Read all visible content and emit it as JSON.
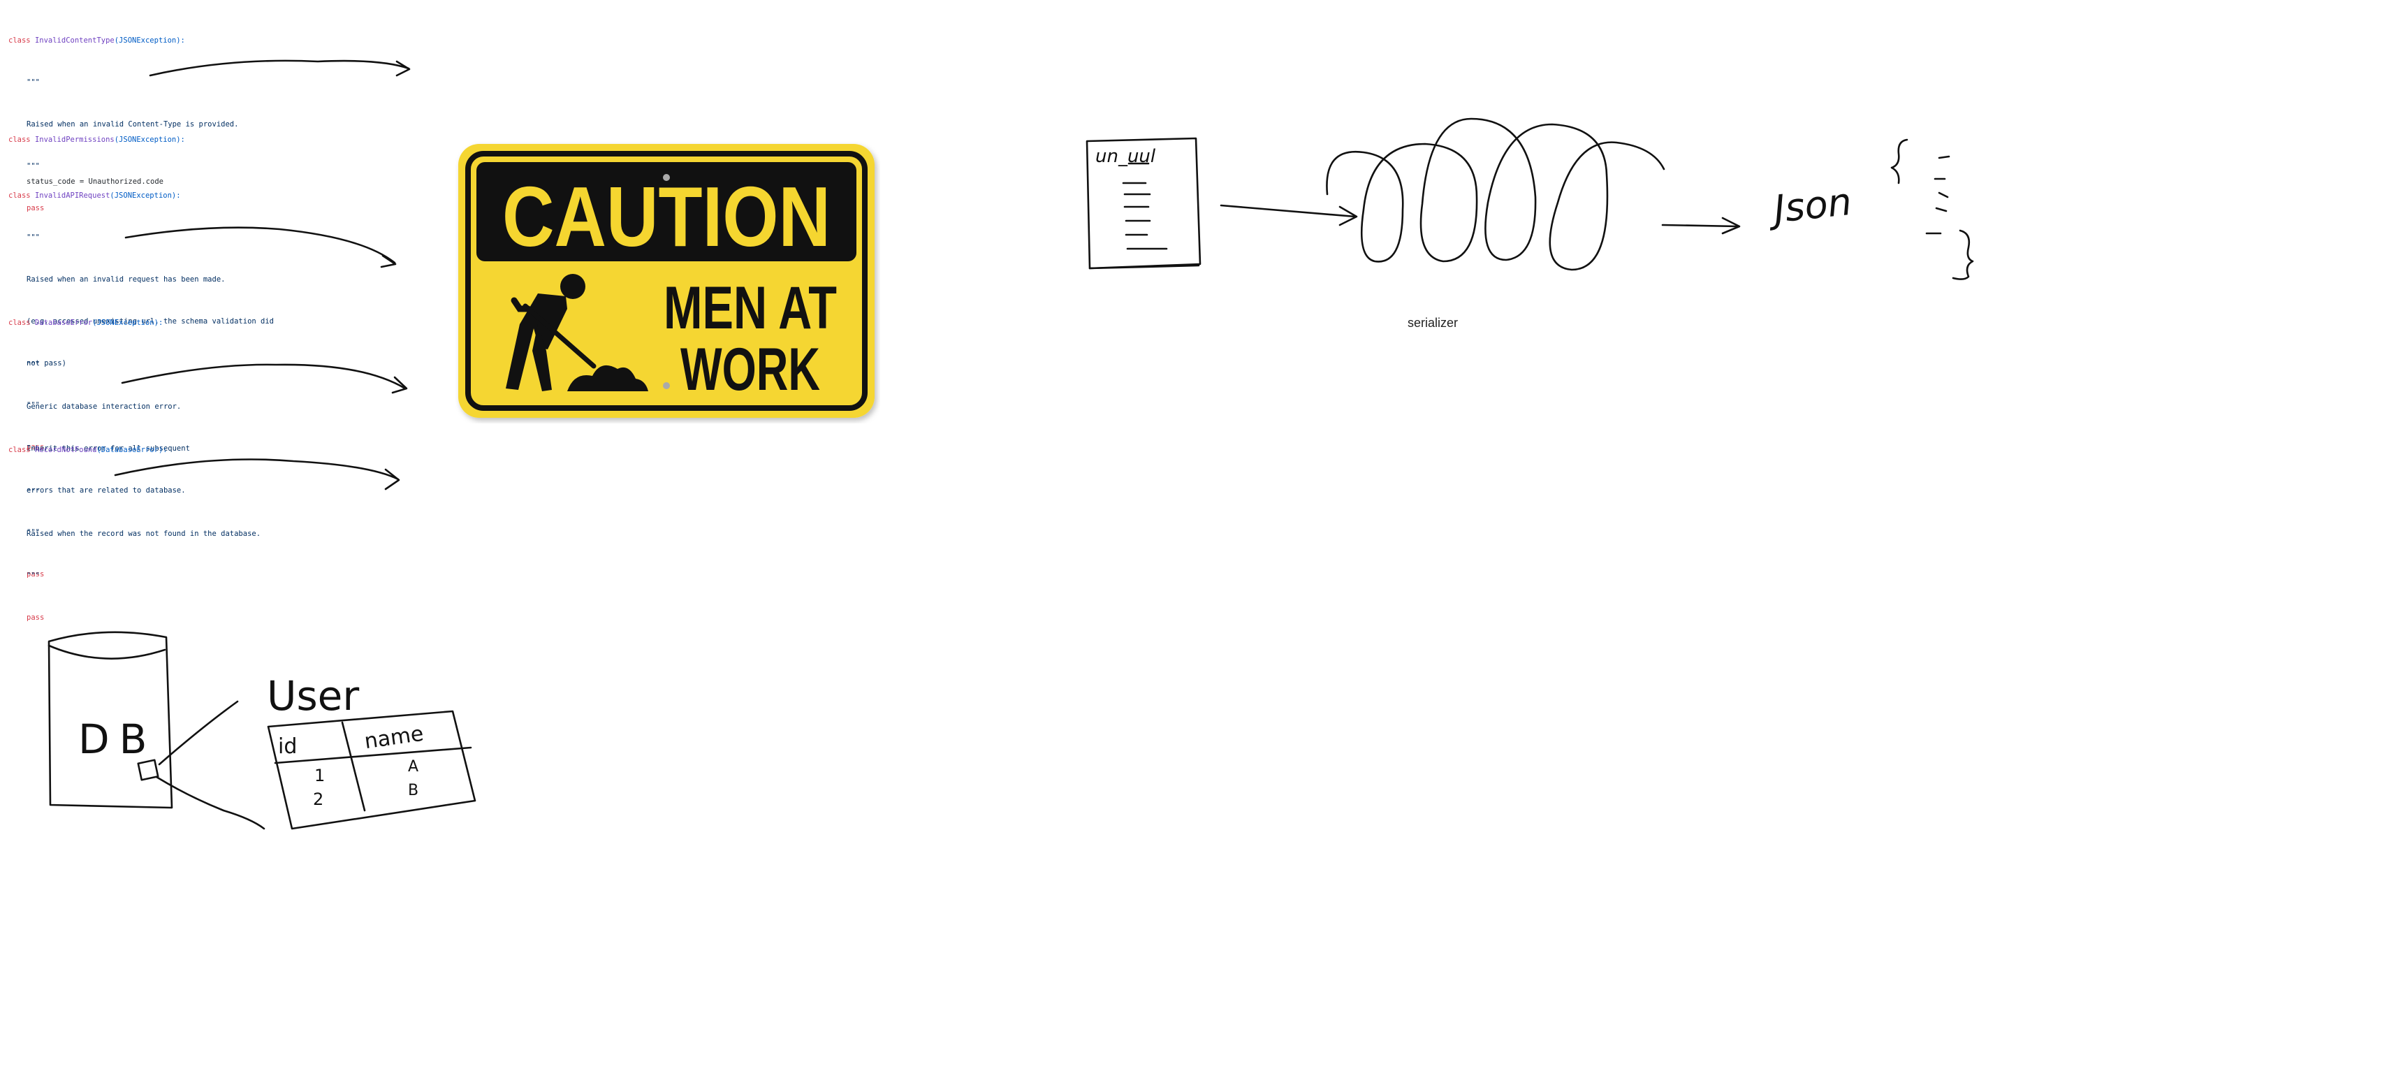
{
  "code": {
    "keyword": "class",
    "docstring_delim": "\"\"\"",
    "pass_kw": "pass",
    "blocks": [
      {
        "name": "InvalidContentType",
        "base": "(JSONException):",
        "doc": [
          "Raised when an invalid Content-Type is provided."
        ],
        "has_pass": true
      },
      {
        "name": "InvalidPermissions",
        "base": "(JSONException):",
        "body": "status_code = Unauthorized.code"
      },
      {
        "name": "InvalidAPIRequest",
        "base": "(JSONException):",
        "doc": [
          "Raised when an invalid request has been made.",
          "(e.g. accessed unexisting url, the schema validation did",
          "not pass)"
        ],
        "has_pass": true
      },
      {
        "name": "DatabaseError",
        "base": "(JSONException):",
        "doc": [
          "Generic database interaction error.",
          "Inherit this error for all subsequent",
          "errors that are related to database."
        ],
        "has_pass": true
      },
      {
        "name": "RecordNotFound",
        "base": "(DatabaseError):",
        "doc": [
          "Raised when the record was not found in the database."
        ],
        "has_pass": true
      }
    ]
  },
  "sign": {
    "header": "CAUTION",
    "line1": "MEN AT",
    "line2": "WORK",
    "colors": {
      "yellow": "#f5d630",
      "black": "#111111"
    }
  },
  "diagram": {
    "serializer_label": "serializer",
    "object_label": "un_uul",
    "json_label": "Json",
    "db_label": "DB",
    "table_title": "User",
    "table_headers": [
      "id",
      "name"
    ],
    "table_rows": [
      [
        "1",
        "A"
      ],
      [
        "2",
        "B"
      ]
    ]
  }
}
